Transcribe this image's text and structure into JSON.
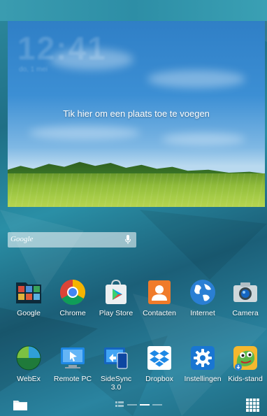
{
  "widget": {
    "clock_time": "12:41",
    "clock_date": "do, 1 mei",
    "prompt": "Tik hier om een plaats toe te voegen"
  },
  "search": {
    "logo_text": "Google",
    "mic_icon": "microphone-icon"
  },
  "apps": [
    {
      "label": "Google",
      "icon": "google-folder-icon"
    },
    {
      "label": "Chrome",
      "icon": "chrome-icon"
    },
    {
      "label": "Play Store",
      "icon": "play-store-icon"
    },
    {
      "label": "Contacten",
      "icon": "contacts-icon"
    },
    {
      "label": "Internet",
      "icon": "internet-globe-icon"
    },
    {
      "label": "Camera",
      "icon": "camera-icon"
    },
    {
      "label": "WebEx",
      "icon": "webex-icon"
    },
    {
      "label": "Remote PC",
      "icon": "remote-pc-icon"
    },
    {
      "label": "SideSync\n3.0",
      "icon": "sidesync-icon"
    },
    {
      "label": "Dropbox",
      "icon": "dropbox-icon"
    },
    {
      "label": "Instellingen",
      "icon": "settings-gear-icon"
    },
    {
      "label": "Kids-stand",
      "icon": "kids-mode-icon"
    }
  ],
  "dock": {
    "left_icon": "folder-icon",
    "right_icon": "app-drawer-grid-icon",
    "page_indicator": "home-pages-indicator"
  }
}
